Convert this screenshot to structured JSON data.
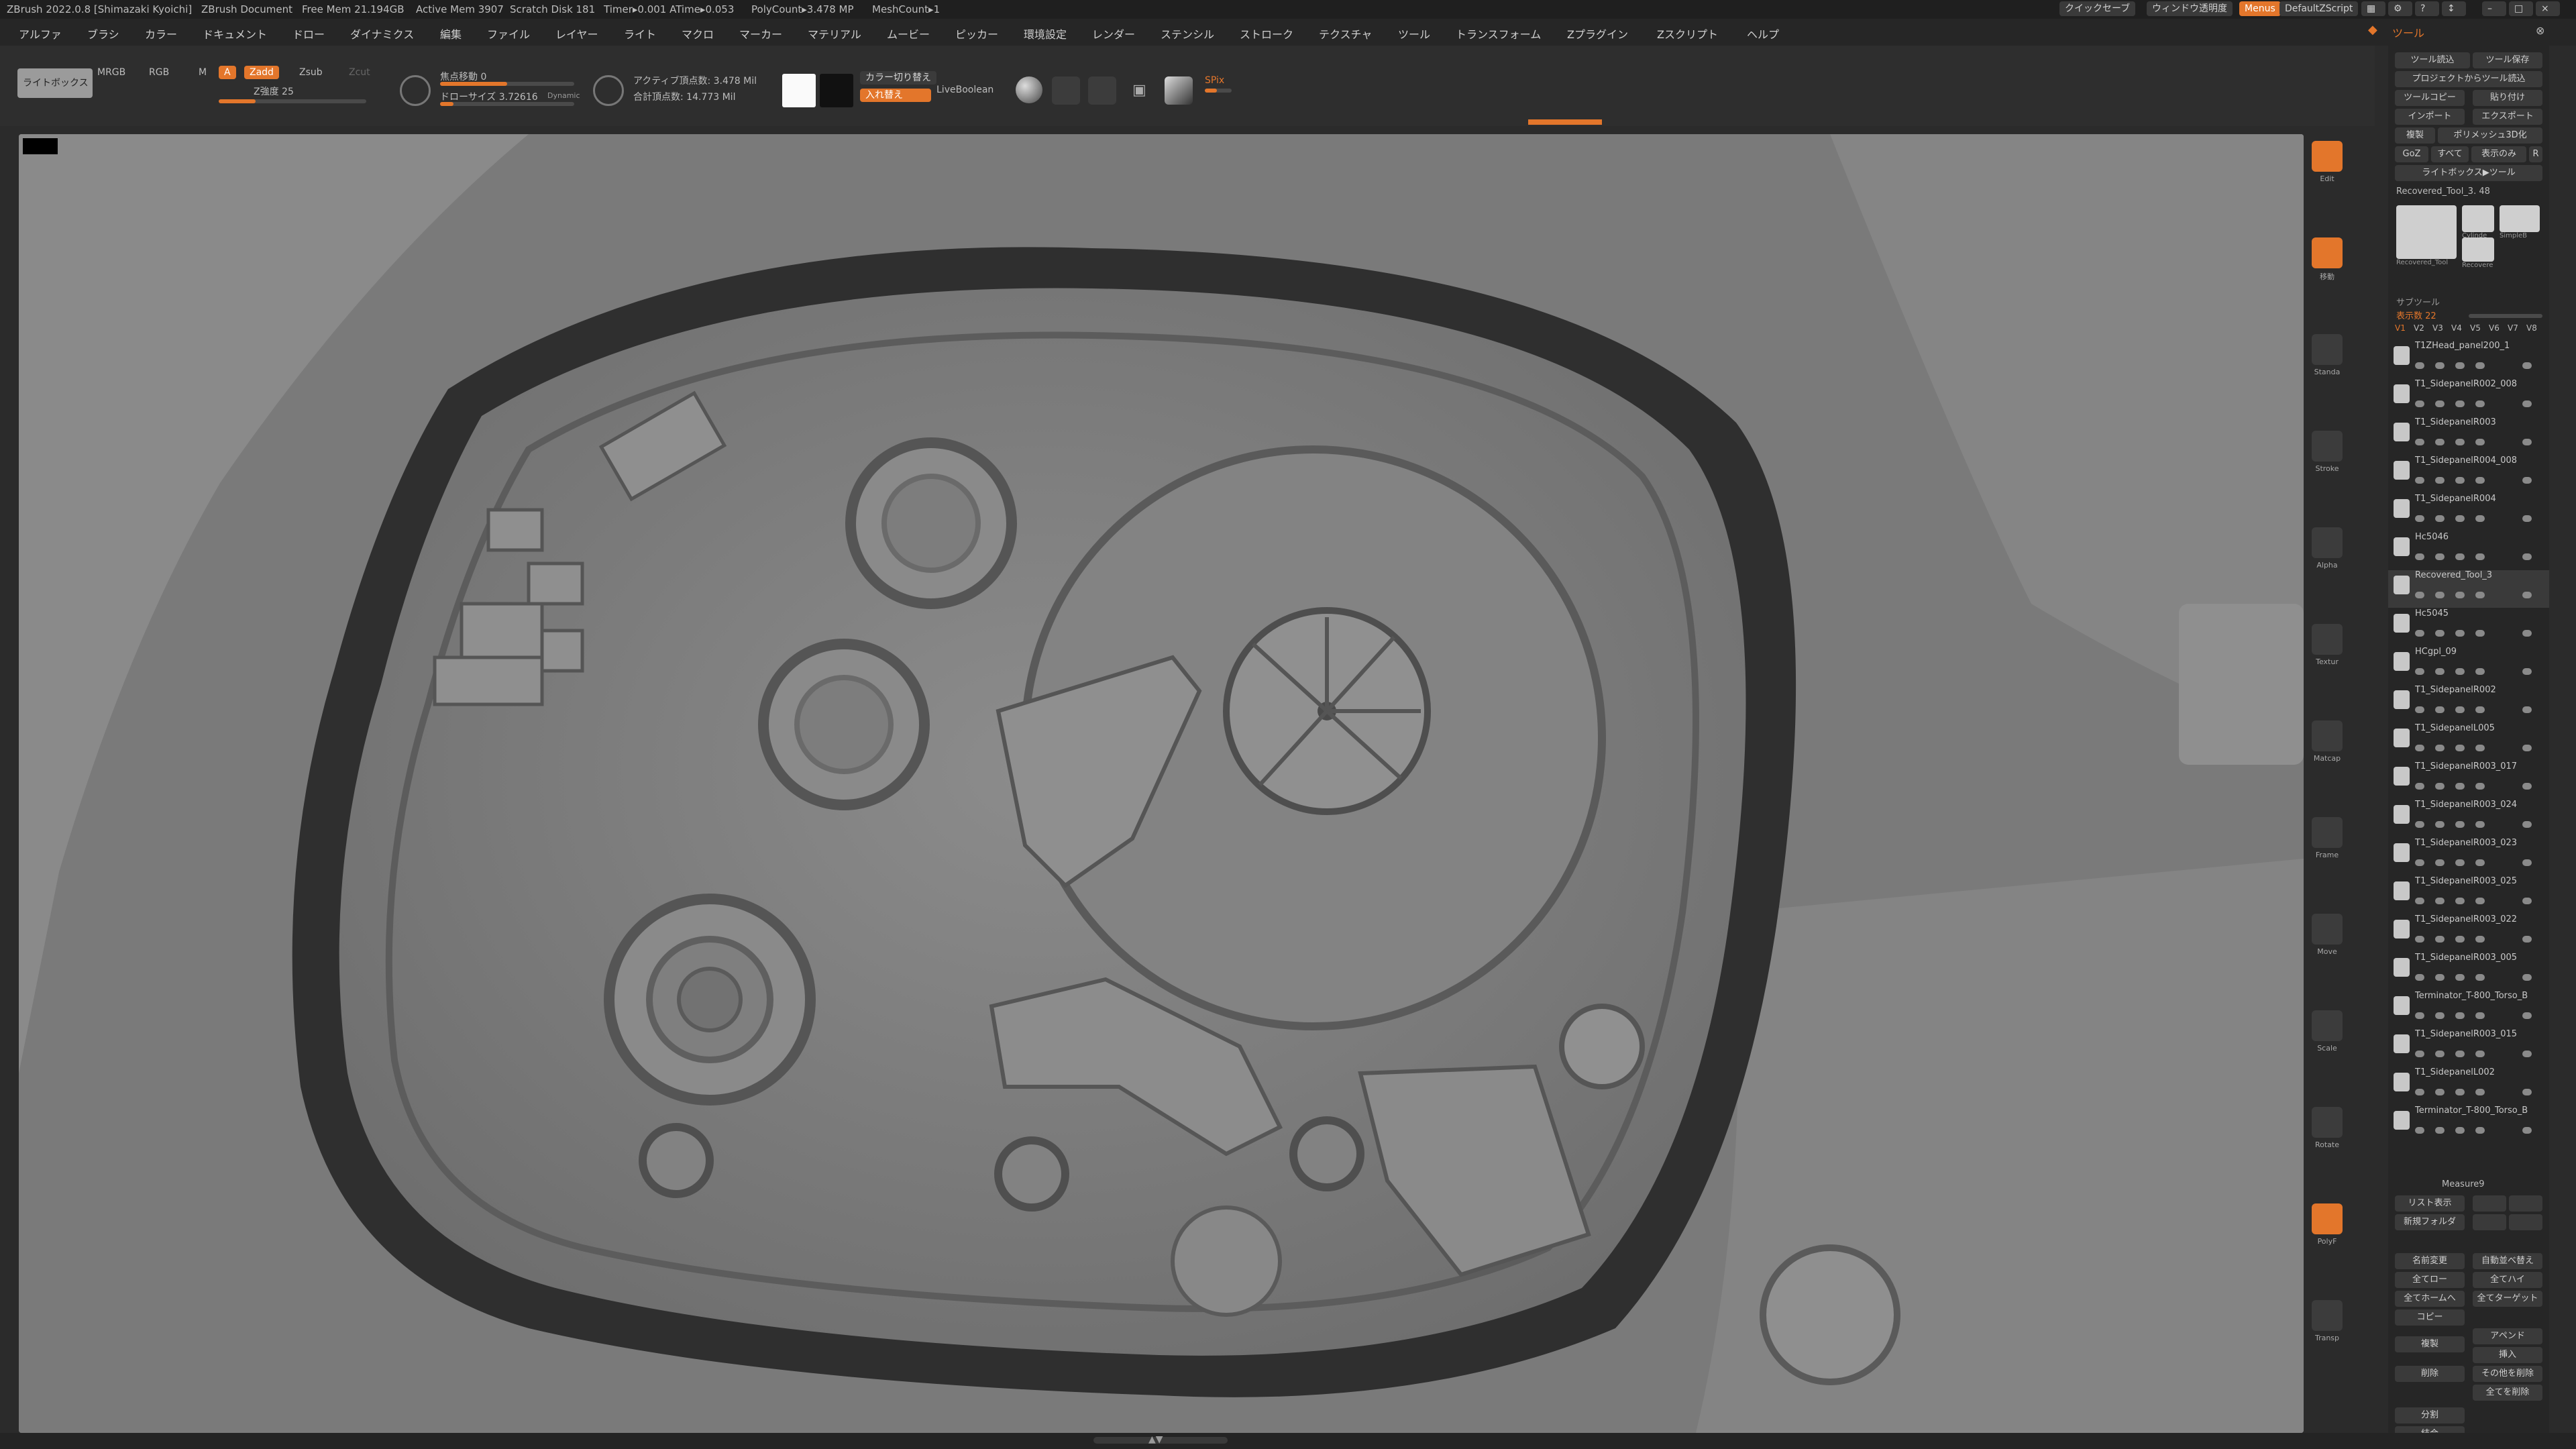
{
  "titlebar": {
    "app": "ZBrush 2022.0.8 [Shimazaki Kyoichi]",
    "document": "ZBrush Document",
    "free_mem": "Free Mem 21.194GB",
    "active_mem": "Active Mem 3907",
    "scratch": "Scratch Disk 181",
    "timer": "Timer▸0.001 ATime▸0.053",
    "polycount": "PolyCount▸3.478 MP",
    "meshcount": "MeshCount▸1",
    "quicksave": "クイックセーブ",
    "window_transparency": "ウィンドウ透明度",
    "menus": "Menus",
    "script": "DefaultZScript"
  },
  "menubar": {
    "items": [
      "アルファ",
      "ブラシ",
      "カラー",
      "ドキュメント",
      "ドロー",
      "ダイナミクス",
      "編集",
      "ファイル",
      "レイヤー",
      "ライト",
      "マクロ",
      "マーカー",
      "マテリアル",
      "ムービー",
      "ピッカー",
      "環境設定",
      "レンダー",
      "ステンシル",
      "ストローク",
      "テクスチャ",
      "ツール",
      "トランスフォーム",
      "Zプラグイン",
      "Zスクリプト",
      "ヘルプ"
    ],
    "tool_menu": "ツール"
  },
  "shelf": {
    "lightbox": "ライトボックス",
    "mrgb": "MRGB",
    "rgb": "RGB",
    "m": "M",
    "a": "A",
    "zadd": "Zadd",
    "zsub": "Zsub",
    "zcut": "Zcut",
    "z_intensity": "Z強度 25",
    "z_intensity_value": 0.25,
    "focal_shift": "焦点移動 0",
    "draw_size": "ドローサイズ 3.72616",
    "dynamic": "Dynamic",
    "active_points": "アクティブ頂点数: 3.478 Mil",
    "total_points": "合計頂点数: 14.773 Mil",
    "color_switch": "カラー切り替え",
    "swap": "入れ替え",
    "livebool": "LiveBoolean",
    "spix": "SPix",
    "spix_value": 3
  },
  "right_shelf": {
    "labels": [
      "Edit",
      "移動",
      "Standa",
      "Stroke",
      "Alpha",
      "Textur",
      "Matcap",
      "Frame",
      "Move",
      "Scale",
      "Rotate",
      "PolyF",
      "Transp"
    ],
    "active_index": 0,
    "orange_indices": [
      0,
      1,
      11
    ]
  },
  "palette": {
    "title": "ツール",
    "buttons": [
      {
        "label": "ツール読込"
      },
      {
        "label": "ツール保存"
      },
      {
        "label": "プロジェクトからツール読込"
      },
      {
        "label": "ツールコピー"
      },
      {
        "label": "貼り付け"
      },
      {
        "label": "インポート"
      },
      {
        "label": "エクスポート"
      },
      {
        "label": "複製"
      },
      {
        "label": "ポリメッシュ3D化"
      },
      {
        "label": "GoZ"
      },
      {
        "label": "すべて"
      },
      {
        "label": "表示のみ"
      },
      {
        "label": "R"
      },
      {
        "label": "ライトボックス▶ツール"
      }
    ],
    "current_tool": "Recovered_Tool_3. 48",
    "thumbs": [
      "Recovered_Tool",
      "Cylinde",
      "SimpleB",
      "Recovere"
    ],
    "subtool_header": "サブツール",
    "display_count": "表示数 22",
    "versions": [
      "V1",
      "V2",
      "V3",
      "V4",
      "V5",
      "V6",
      "V7",
      "V8"
    ],
    "subtools": [
      "T1ZHead_panel200_1",
      "T1_SidepanelR002_008",
      "T1_SidepanelR003",
      "T1_SidepanelR004_008",
      "T1_SidepanelR004",
      "Hc5046",
      "Recovered_Tool_3",
      "Hc5045",
      "HCgpl_09",
      "T1_SidepanelR002",
      "T1_SidepanelL005",
      "T1_SidepanelR003_017",
      "T1_SidepanelR003_024",
      "T1_SidepanelR003_023",
      "T1_SidepanelR003_025",
      "T1_SidepanelR003_022",
      "T1_SidepanelR003_005",
      "Terminator_T-800_Torso_B",
      "T1_SidepanelR003_015",
      "T1_SidepanelL002",
      "Terminator_T-800_Torso_B"
    ],
    "active_subtool_index": 6,
    "measure": "Measure9",
    "list_show": "リスト表示",
    "new_folder": "新規フォルダ",
    "bottom_buttons": [
      {
        "label": "名前変更"
      },
      {
        "label": "自動並べ替え"
      },
      {
        "label": "全てロー"
      },
      {
        "label": "全てハイ"
      },
      {
        "label": "全てホームへ"
      },
      {
        "label": "全てターゲット"
      },
      {
        "label": "コピー"
      },
      {
        "label": "複製"
      },
      {
        "label": "アペンド"
      },
      {
        "label": "挿入"
      },
      {
        "label": "削除"
      },
      {
        "label": "その他を削除"
      },
      {
        "label": "全てを削除"
      },
      {
        "label": "分割"
      },
      {
        "label": "結合"
      }
    ]
  },
  "colors": {
    "accent": "#e3762b",
    "bg": "#2b2b2b",
    "viewport_clay": "#7b7b7b"
  }
}
